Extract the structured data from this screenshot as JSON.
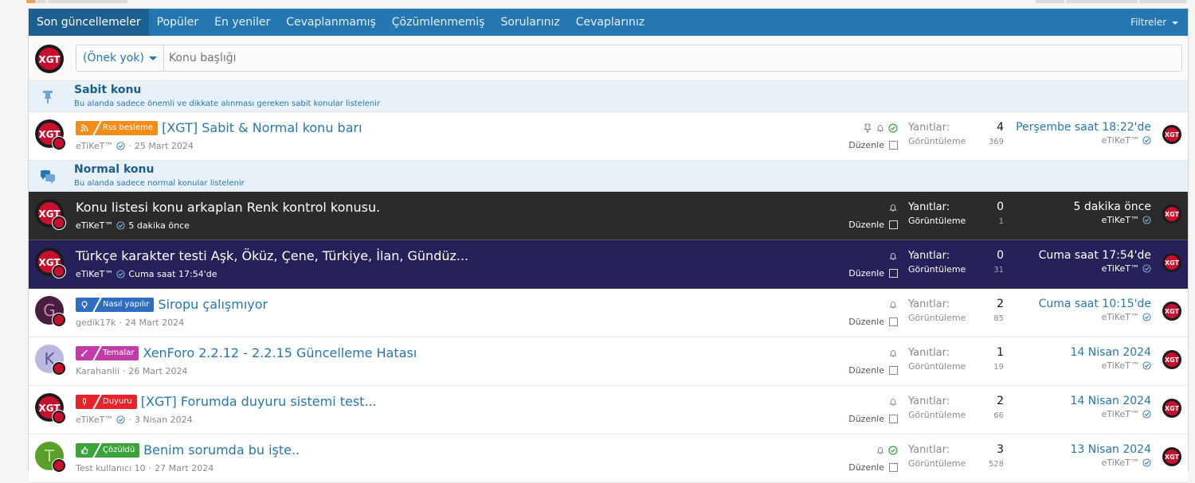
{
  "tabs": [
    "Son güncellemeler",
    "Popüler",
    "En yeniler",
    "Cevaplanmamış",
    "Çözümlenmemiş",
    "Sorularınız",
    "Cevaplarınız"
  ],
  "filters_label": "Filtreler",
  "new_thread": {
    "prefix": "(Önek yok)",
    "placeholder": "Konu başlığı"
  },
  "sticky_separator": {
    "title": "Sabit konu",
    "desc": "Bu alanda sadece önemli ve dikkate alınması gereken sabit konular listelenir"
  },
  "normal_separator": {
    "title": "Normal konu",
    "desc": "Bu alanda sadece normal konular listelenir"
  },
  "labels": {
    "edit": "Düzenle",
    "replies": "Yanıtlar:",
    "views": "Görüntüleme:"
  },
  "logo_text": "XGT",
  "threads": [
    {
      "prefix": "Rss besleme",
      "title": "[XGT] Sabit & Normal konu barı",
      "author": "eTiKeT™",
      "date": "25 Mart 2024",
      "replies": "4",
      "views": "369",
      "last_date": "Perşembe saat 18:22'de",
      "last_user": "eTiKeT™"
    },
    {
      "prefix": "",
      "title": "Konu listesi konu arkaplan Renk kontrol konusu.",
      "author": "eTiKeT™",
      "date": "5 dakika önce",
      "replies": "0",
      "views": "1",
      "last_date": "5 dakika önce",
      "last_user": "eTiKeT™"
    },
    {
      "prefix": "",
      "title": "Türkçe karakter testi Aşk, Öküz, Çene, Türkiye, İlan, Gündüz...",
      "author": "eTiKeT™",
      "date": "Cuma saat 17:54'de",
      "replies": "0",
      "views": "31",
      "last_date": "Cuma saat 17:54'de",
      "last_user": "eTiKeT™"
    },
    {
      "prefix": "Nasıl yapılır",
      "title": "Siropu çalışmıyor",
      "author": "gedik17k",
      "date": "24 Mart 2024",
      "avatar_letter": "G",
      "replies": "2",
      "views": "85",
      "last_date": "Cuma saat 10:15'de",
      "last_user": "eTiKeT™"
    },
    {
      "prefix": "Temalar",
      "title": "XenForo 2.2.12 - 2.2.15 Güncelleme Hatası",
      "author": "Karahanlii",
      "date": "26 Mart 2024",
      "avatar_letter": "K",
      "replies": "1",
      "views": "19",
      "last_date": "14 Nisan 2024",
      "last_user": "eTiKeT™"
    },
    {
      "prefix": "Duyuru",
      "title": "[XGT] Forumda duyuru sistemi test...",
      "author": "eTiKeT™",
      "date": "3 Nisan 2024",
      "replies": "2",
      "views": "66",
      "last_date": "14 Nisan 2024",
      "last_user": "eTiKeT™"
    },
    {
      "prefix": "Çözüldü",
      "title": "Benim sorumda bu işte..",
      "author": "Test kullanıcı 10",
      "date": "27 Mart 2024",
      "avatar_letter": "T",
      "replies": "3",
      "views": "528",
      "last_date": "13 Nisan 2024",
      "last_user": "eTiKeT™"
    }
  ],
  "colors": {
    "accent": "#2577b1",
    "rss": "#f28c1a",
    "howto": "#2e6dc0",
    "themes": "#c23ba6",
    "notice": "#e8232a",
    "solved": "#3aa33a"
  },
  "icons": [
    "pin-icon",
    "chat-icon",
    "rss-icon",
    "bell-icon",
    "check-circle-icon",
    "bulb-icon",
    "brush-icon",
    "alert-icon",
    "thumbs-up-icon",
    "verified-icon"
  ]
}
